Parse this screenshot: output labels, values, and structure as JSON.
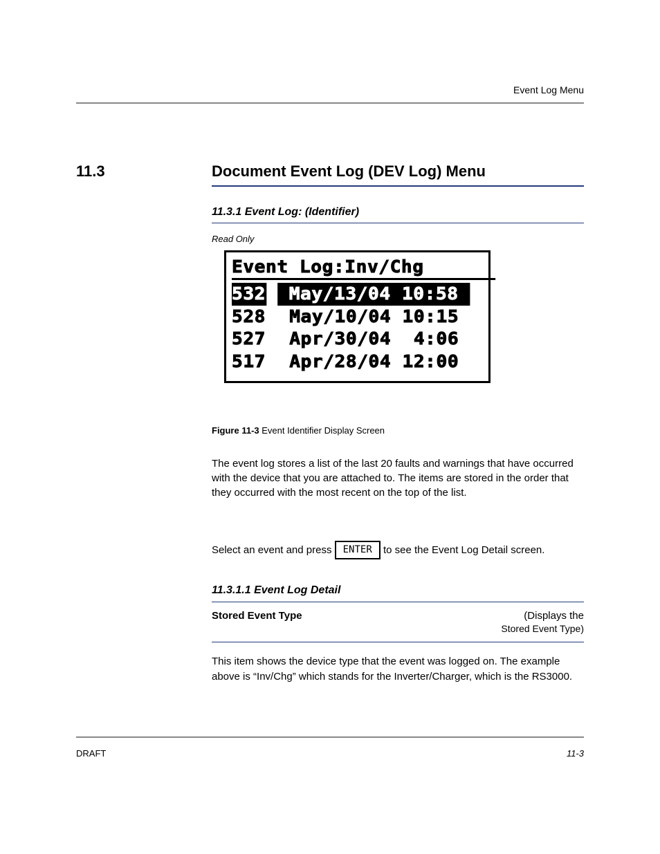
{
  "header": {
    "title": "Event Log Menu"
  },
  "section": {
    "number": "11.3",
    "heading": "Document Event Log (DEV Log) Menu",
    "attrib": "Read Only",
    "sub1": "11.3.1 Event Log: (Identifier)"
  },
  "lcd": {
    "title": "Event Log:Inv/Chg",
    "rows": [
      {
        "id": "532",
        "rest": "May/13/04 10:58",
        "selected": true
      },
      {
        "id": "528",
        "rest": "May/10/04 10:15",
        "selected": false
      },
      {
        "id": "527",
        "rest": "Apr/30/04  4:06",
        "selected": false
      },
      {
        "id": "517",
        "rest": "Apr/28/04 12:00",
        "selected": false
      }
    ]
  },
  "figure": {
    "num": "Figure 11-3",
    "caption": "Event Identifier Display Screen"
  },
  "para": {
    "p1": "The event log stores a list of the last 20 faults and warnings that have occurred with the device that you are attached to. The items are stored in the order that they occurred with the most recent on the top of the list.",
    "p2a": "Select an event and press ",
    "key": "ENTER",
    "p2b": " to see the Event Log Detail screen.",
    "p3": "This item shows the device type that the event was logged on. The example above is “Inv/Chg” which stands for the Inverter/Charger, which is the RS3000."
  },
  "sub2": {
    "heading": "11.3.1.1 Event Log Detail",
    "thead_l": "Stored Event Type",
    "thead_r_a": "(Displays the",
    "thead_r_b": "Stored Event Type)"
  },
  "footer": {
    "left": "DRAFT",
    "right": "11-3"
  }
}
